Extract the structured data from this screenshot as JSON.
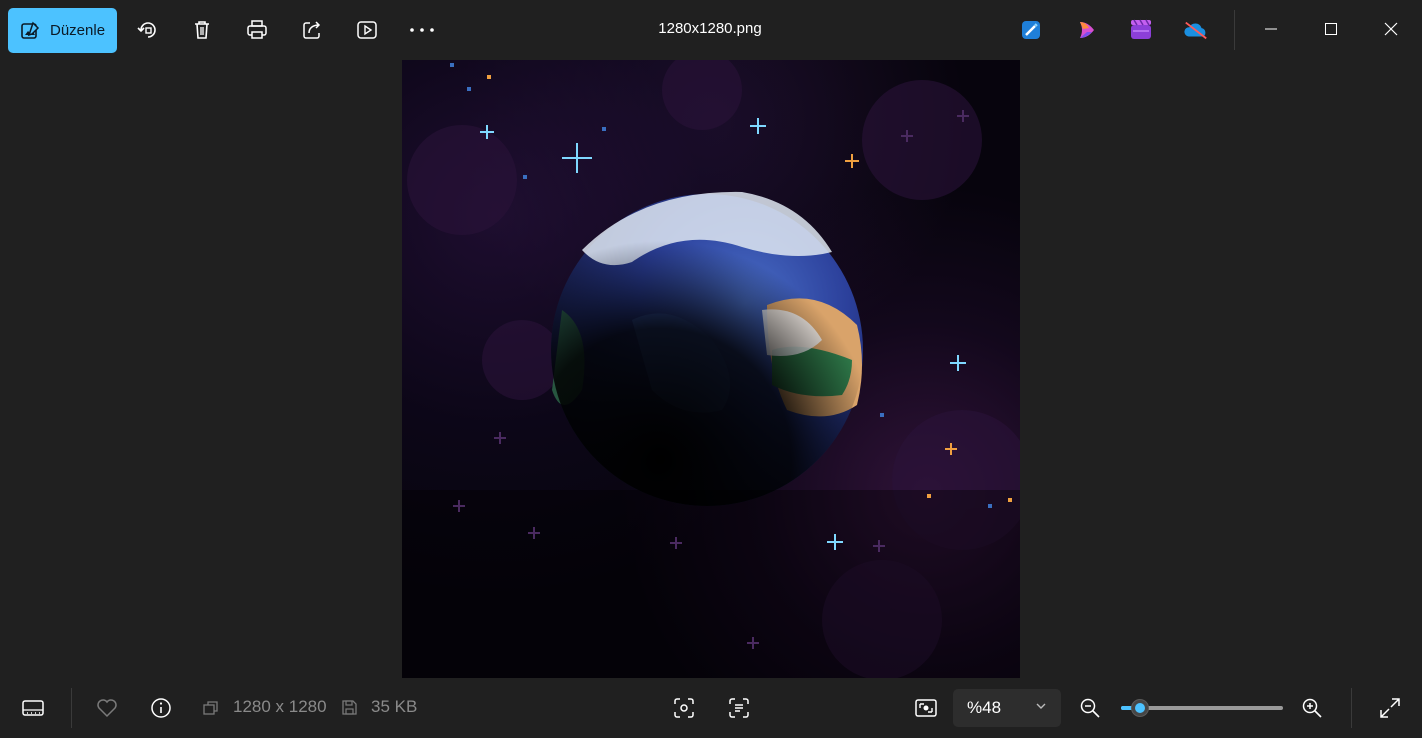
{
  "toolbar": {
    "edit_label": "Düzenle",
    "icons": [
      "rotate-icon",
      "delete-icon",
      "print-icon",
      "share-icon",
      "slideshow-icon",
      "more-icon"
    ]
  },
  "window": {
    "title": "1280x1280.png"
  },
  "pinned_apps": [
    "photo-editor-app-icon",
    "copilot-app-icon",
    "clipchamp-app-icon",
    "onedrive-app-icon"
  ],
  "image": {
    "description_icon": "earth-pixel-art-image"
  },
  "footer": {
    "dimensions": "1280 x 1280",
    "file_size": "35 KB",
    "zoom_label": "%48",
    "zoom_fraction": 0.12
  },
  "colors": {
    "accent": "#4cc2ff",
    "background": "#202020",
    "muted_text": "#8a8a8a"
  }
}
